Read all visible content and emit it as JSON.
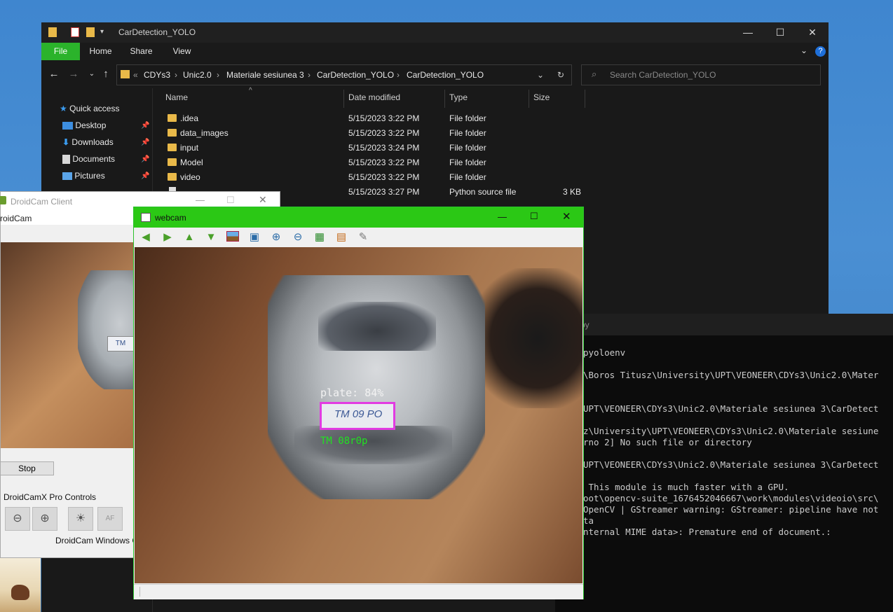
{
  "explorer": {
    "title": "CarDetection_YOLO",
    "ribbon_tabs": [
      "File",
      "Home",
      "Share",
      "View"
    ],
    "breadcrumbs": [
      "CDYs3",
      "Unic2.0",
      "Materiale sesiunea 3",
      "CarDetection_YOLO",
      "CarDetection_YOLO"
    ],
    "breadcrumb_overflow": "«",
    "search_placeholder": "Search CarDetection_YOLO",
    "sidebar": [
      {
        "label": "Quick access",
        "pinned": false
      },
      {
        "label": "Desktop",
        "pinned": true
      },
      {
        "label": "Downloads",
        "pinned": true
      },
      {
        "label": "Documents",
        "pinned": true
      },
      {
        "label": "Pictures",
        "pinned": true
      }
    ],
    "columns": {
      "name": "Name",
      "date": "Date modified",
      "type": "Type",
      "size": "Size"
    },
    "files": [
      {
        "name": ".idea",
        "date": "5/15/2023 3:22 PM",
        "type": "File folder",
        "size": "",
        "kind": "folder"
      },
      {
        "name": "data_images",
        "date": "5/15/2023 3:22 PM",
        "type": "File folder",
        "size": "",
        "kind": "folder"
      },
      {
        "name": "input",
        "date": "5/15/2023 3:24 PM",
        "type": "File folder",
        "size": "",
        "kind": "folder"
      },
      {
        "name": "Model",
        "date": "5/15/2023 3:22 PM",
        "type": "File folder",
        "size": "",
        "kind": "folder"
      },
      {
        "name": "video",
        "date": "5/15/2023 3:22 PM",
        "type": "File folder",
        "size": "",
        "kind": "folder"
      },
      {
        "name": "",
        "date": "5/15/2023 3:27 PM",
        "type": "Python source file",
        "size": "3 KB",
        "kind": "file"
      }
    ]
  },
  "console": {
    "title_fragment": "py",
    "lines": [
      "pyoloenv",
      "",
      "\\Boros Titusz\\University\\UPT\\VEONEER\\CDYs3\\Unic2.0\\Mater",
      "",
      "",
      "UPT\\VEONEER\\CDYs3\\Unic2.0\\Materiale sesiunea 3\\CarDetect",
      "",
      "z\\University\\UPT\\VEONEER\\CDYs3\\Unic2.0\\Materiale sesiune",
      "rno 2] No such file or directory",
      "",
      "UPT\\VEONEER\\CDYs3\\Unic2.0\\Materiale sesiunea 3\\CarDetect",
      "",
      " This module is much faster with a GPU.",
      "oot\\opencv-suite_1676452046667\\work\\modules\\videoio\\src\\",
      "OpenCV | GStreamer warning: GStreamer: pipeline have not",
      "ta",
      "nternal MIME data>: Premature end of document.:"
    ]
  },
  "droidcam": {
    "title": "DroidCam Client",
    "menu_fragment": "roidCam",
    "stop_label": "Stop",
    "controls_label": "DroidCamX Pro Controls",
    "af_label": "AF",
    "footer": "DroidCam Windows Clie"
  },
  "webcam": {
    "title": "webcam",
    "detection_label": "plate: 84%",
    "ocr_text": "TM 08r0p",
    "plate_text": "TM 09 PO",
    "toolbar": [
      "arrow-left",
      "arrow-right",
      "arrow-up",
      "arrow-down",
      "image",
      "zoom-fit",
      "zoom-in",
      "zoom-out",
      "save",
      "copy",
      "properties"
    ]
  },
  "colors": {
    "accent_green": "#2bc815",
    "file_tab_green": "#2bb32b",
    "detection_box": "#e23be2",
    "ocr_text": "#22e022"
  }
}
